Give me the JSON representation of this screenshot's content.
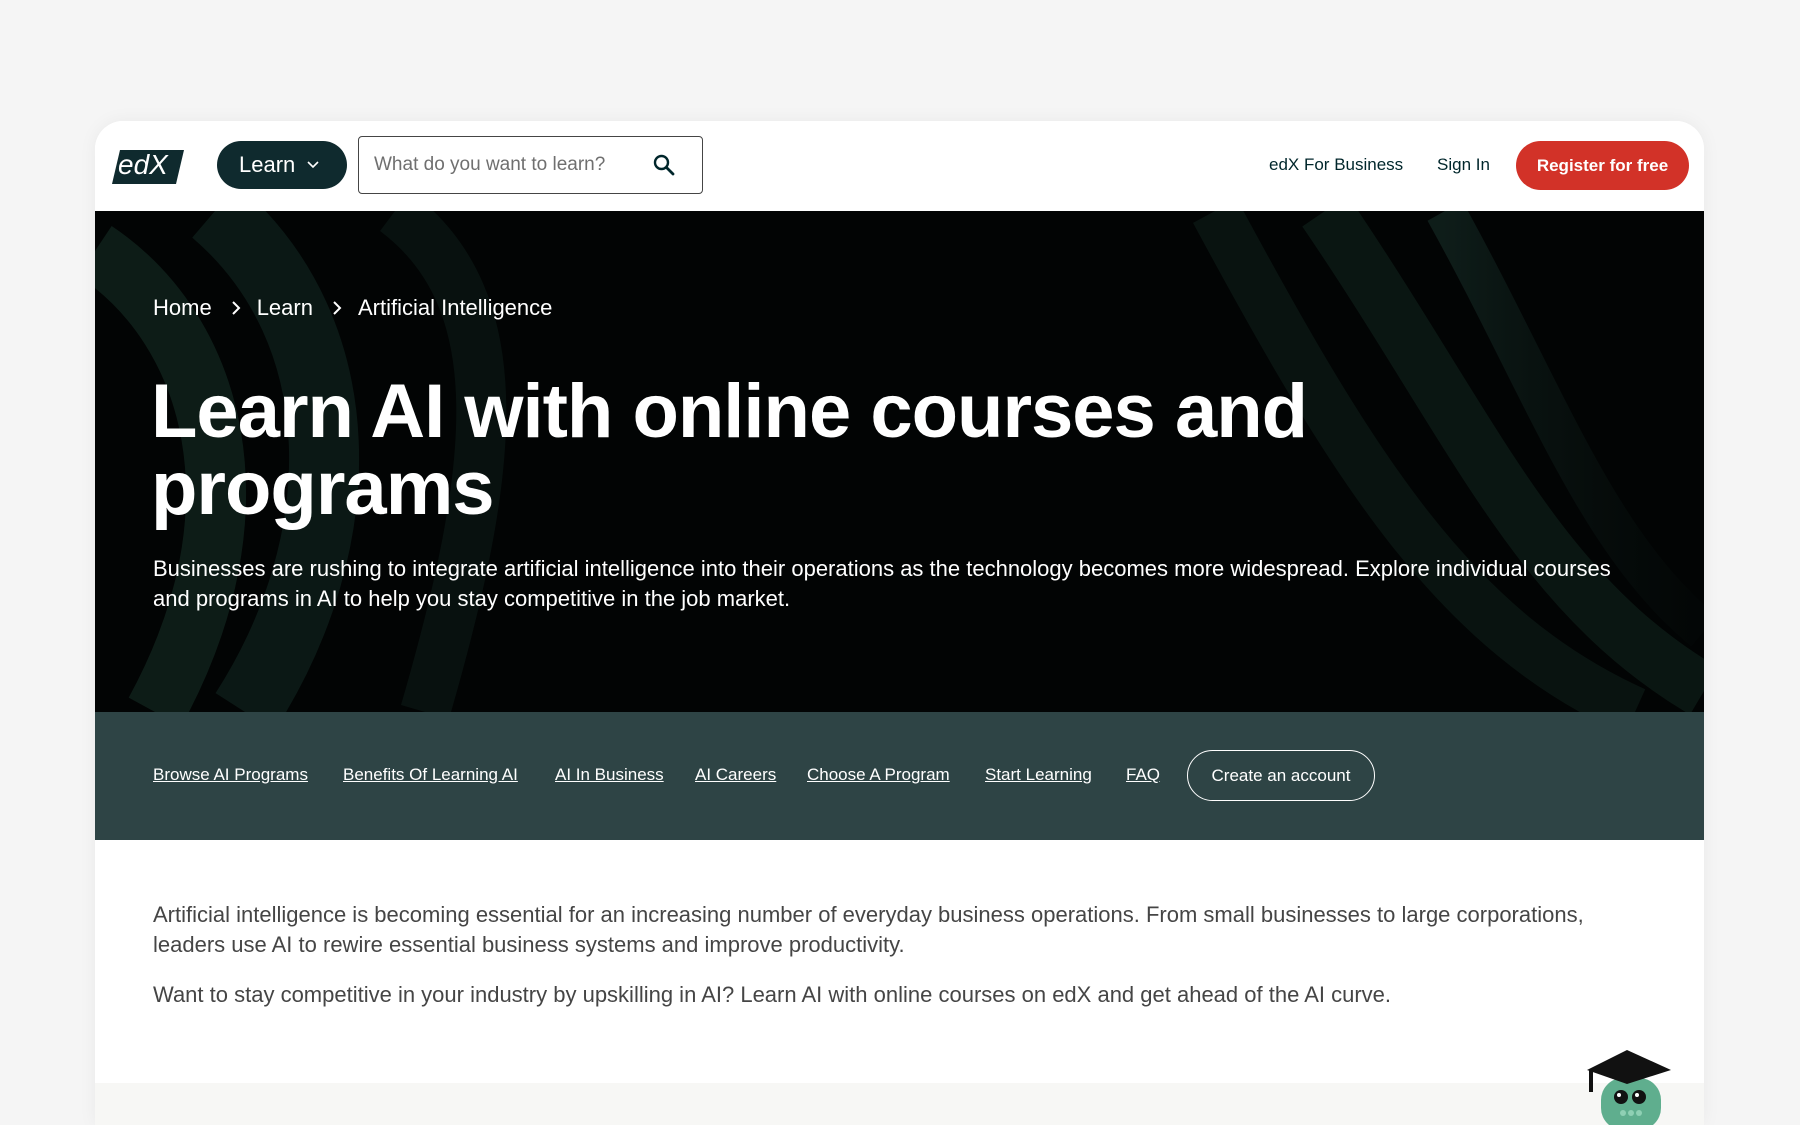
{
  "header": {
    "logo_text": "edX",
    "learn_label": "Learn",
    "search_placeholder": "What do you want to learn?",
    "business_link": "edX For Business",
    "signin_link": "Sign In",
    "register_label": "Register for free"
  },
  "breadcrumb": [
    "Home",
    "Learn",
    "Artificial Intelligence"
  ],
  "hero": {
    "title": "Learn AI with online courses and programs",
    "description": "Businesses are rushing to integrate artificial intelligence into their operations as the technology becomes more widespread. Explore individual courses and programs in AI to help you stay competitive in the job market."
  },
  "subnav": {
    "links": [
      "Browse AI Programs",
      "Benefits Of Learning AI",
      "AI In Business",
      "AI Careers",
      "Choose A Program",
      "Start Learning",
      "FAQ"
    ],
    "account_label": "Create an account"
  },
  "intro": {
    "paragraphs": [
      "Artificial intelligence is becoming essential for an increasing number of everyday business operations. From small businesses to large corporations, leaders use AI to rewire essential business systems and improve productivity.",
      "Want to stay competitive in your industry by upskilling in AI? Learn AI with online courses on edX and get ahead of the AI curve."
    ]
  },
  "colors": {
    "brand_dark": "#0f2a2e",
    "register": "#d23228",
    "subnav_bg": "#2e4445",
    "mascot": "#5fae8e"
  }
}
